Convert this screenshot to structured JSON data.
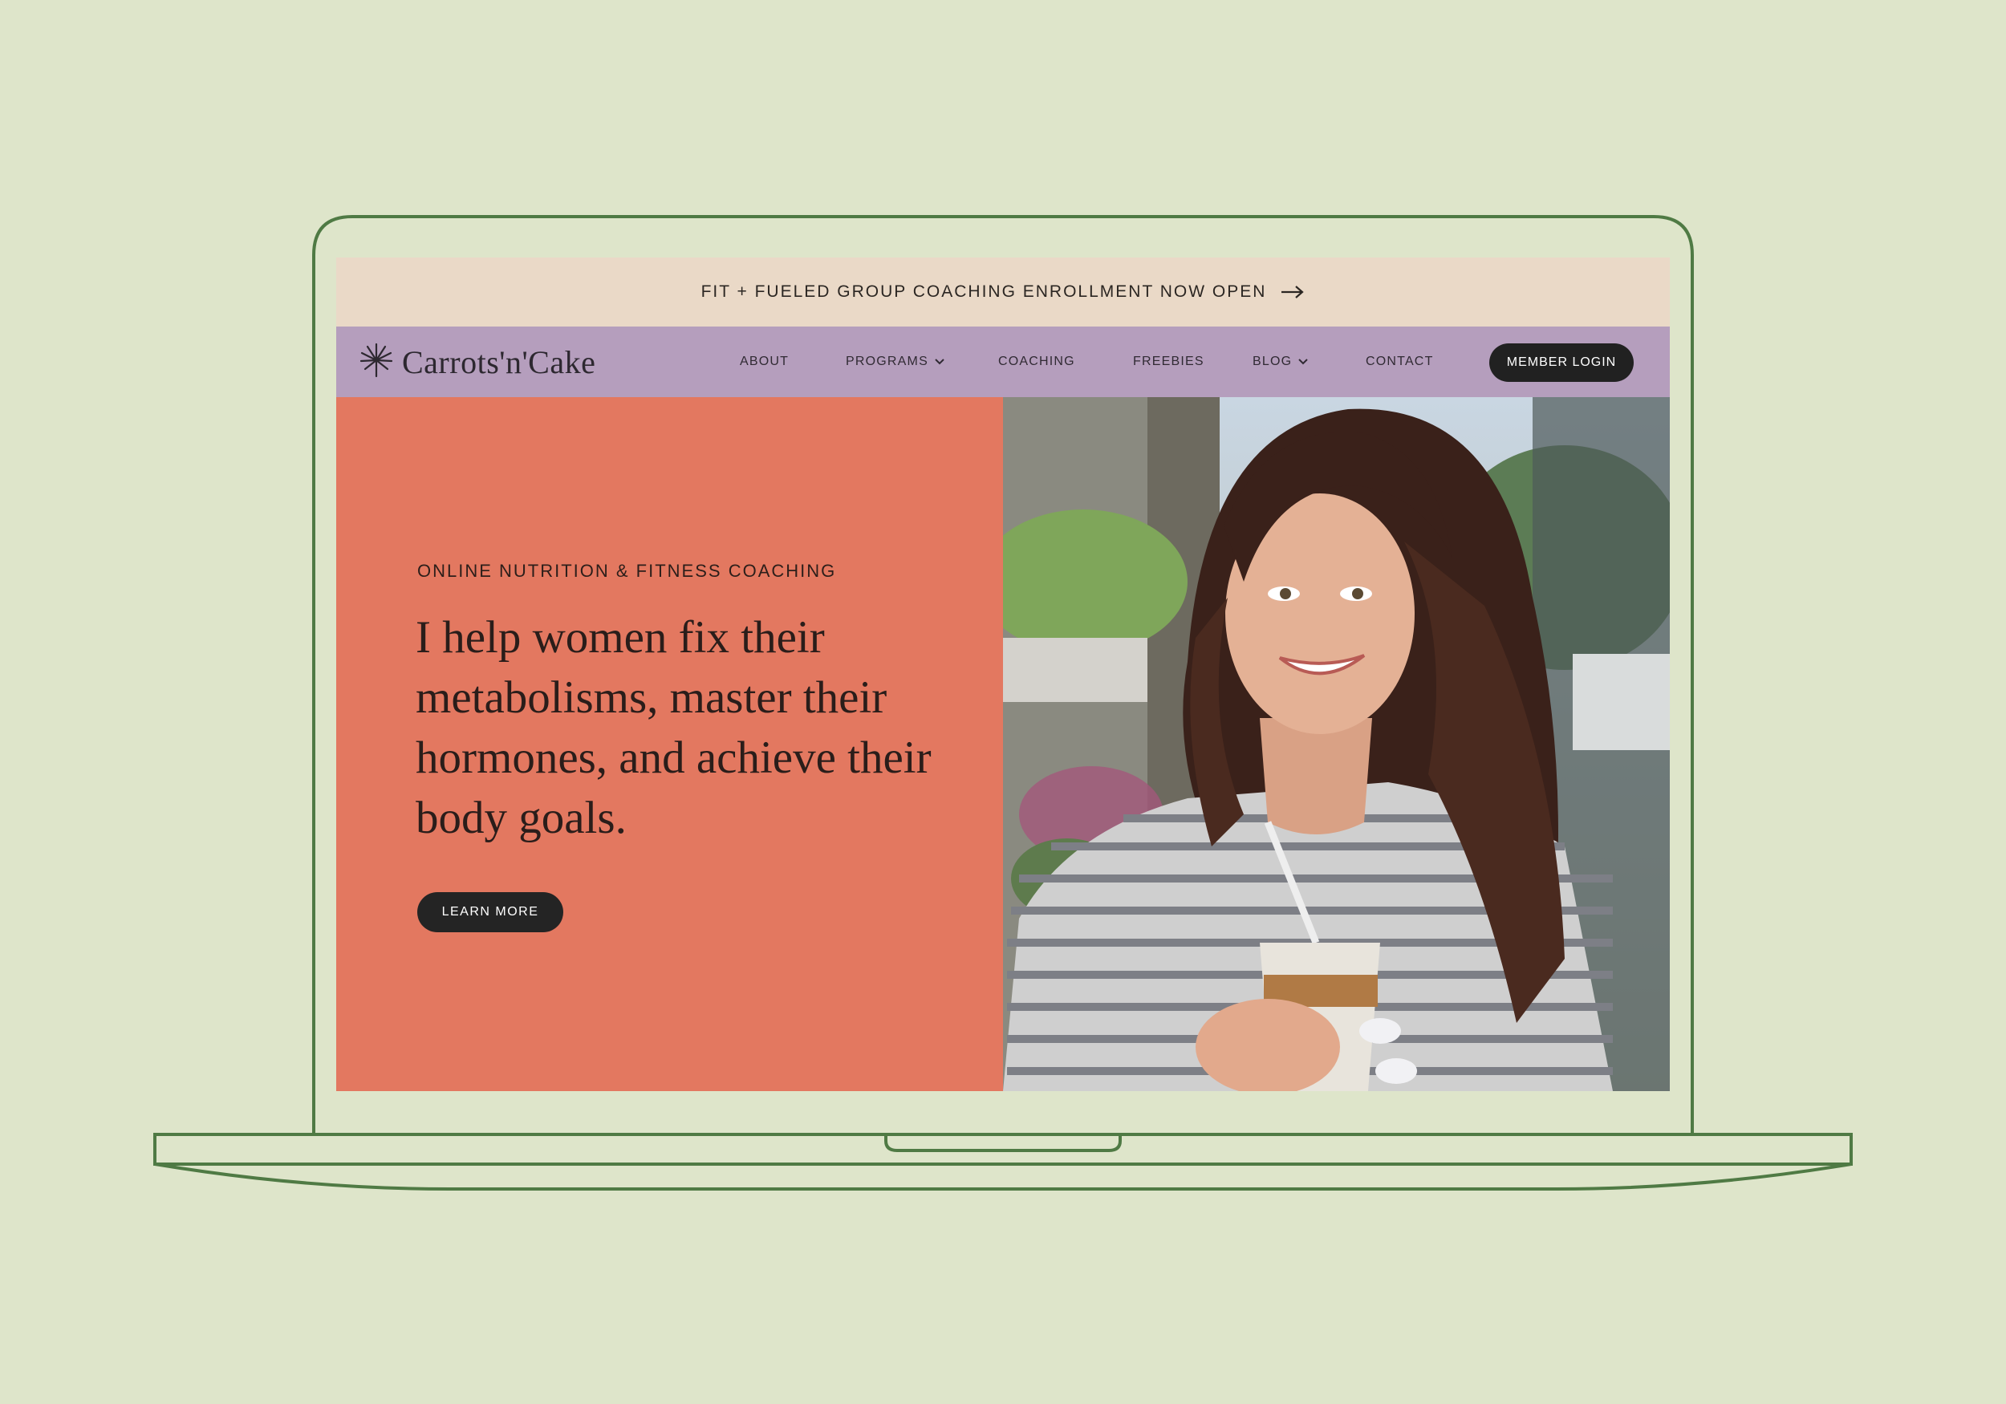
{
  "colors": {
    "page_bg": "#dee5ca",
    "laptop_line": "#4f7a44",
    "announce_bg": "#ead9c7",
    "nav_bg": "#b59ebd",
    "hero_bg": "#e37860",
    "button_bg": "#212121"
  },
  "announcement": {
    "text": "FIT + FUELED GROUP COACHING ENROLLMENT NOW OPEN",
    "icon": "arrow-right-icon"
  },
  "header": {
    "logo_text": "Carrots'n'Cake",
    "logo_icon": "leaf-burst-icon",
    "nav": [
      {
        "label": "ABOUT",
        "has_dropdown": false
      },
      {
        "label": "PROGRAMS",
        "has_dropdown": true
      },
      {
        "label": "COACHING",
        "has_dropdown": false
      },
      {
        "label": "FREEBIES",
        "has_dropdown": false
      },
      {
        "label": "BLOG",
        "has_dropdown": true
      },
      {
        "label": "CONTACT",
        "has_dropdown": false
      }
    ],
    "login_label": "MEMBER LOGIN"
  },
  "hero": {
    "eyebrow": "ONLINE NUTRITION & FITNESS COACHING",
    "headline": "I help women fix their metabolisms, master their hormones, and achieve their body goals.",
    "cta_label": "LEARN MORE"
  }
}
